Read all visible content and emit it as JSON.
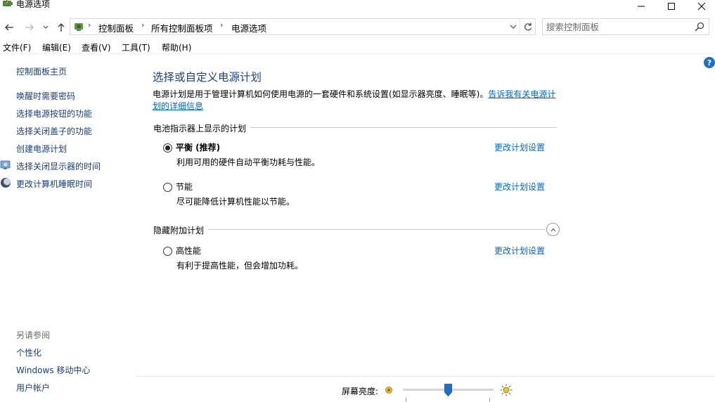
{
  "window": {
    "title": "电源选项",
    "icon": "power-options-icon"
  },
  "nav": {
    "back_icon": "back-arrow-icon",
    "forward_icon": "forward-arrow-icon",
    "recent_icon": "chevron-down-icon",
    "up_icon": "up-arrow-icon"
  },
  "address": {
    "breadcrumbs": [
      "控制面板",
      "所有控制面板项",
      "电源选项"
    ],
    "separator": "›"
  },
  "search": {
    "placeholder": "搜索控制面板"
  },
  "menu": {
    "items": [
      "文件(F)",
      "编辑(E)",
      "查看(V)",
      "工具(T)",
      "帮助(H)"
    ]
  },
  "sidebar": {
    "home": "控制面板主页",
    "links": [
      "唤醒时需要密码",
      "选择电源按钮的功能",
      "选择关闭盖子的功能",
      "创建电源计划",
      "选择关闭显示器的时间",
      "更改计算机睡眠时间"
    ],
    "see_also_label": "另请参阅",
    "see_also": [
      "个性化",
      "Windows 移动中心",
      "用户帐户"
    ]
  },
  "main": {
    "title": "选择或自定义电源计划",
    "intro_text": "电源计划是用于管理计算机如何使用电源的一套硬件和系统设置(如显示器亮度、睡眠等)。",
    "intro_link": "告诉我有关电源计划的详细信息",
    "battery_group": "电池指示器上显示的计划",
    "hidden_group": "隐藏附加计划",
    "plans": [
      {
        "name": "平衡 (推荐)",
        "desc": "利用可用的硬件自动平衡功耗与性能。",
        "link": "更改计划设置",
        "selected": true
      },
      {
        "name": "节能",
        "desc": "尽可能降低计算机性能以节能。",
        "link": "更改计划设置",
        "selected": false
      },
      {
        "name": "高性能",
        "desc": "有利于提高性能，但会增加功耗。",
        "link": "更改计划设置",
        "selected": false
      }
    ]
  },
  "brightness": {
    "label": "屏幕亮度:",
    "level_fraction": 0.5
  },
  "colors": {
    "link": "#0066cc",
    "title": "#1e3f8a",
    "sidebar_link": "#1a3f7a",
    "slider_thumb": "#1e6fc8"
  }
}
